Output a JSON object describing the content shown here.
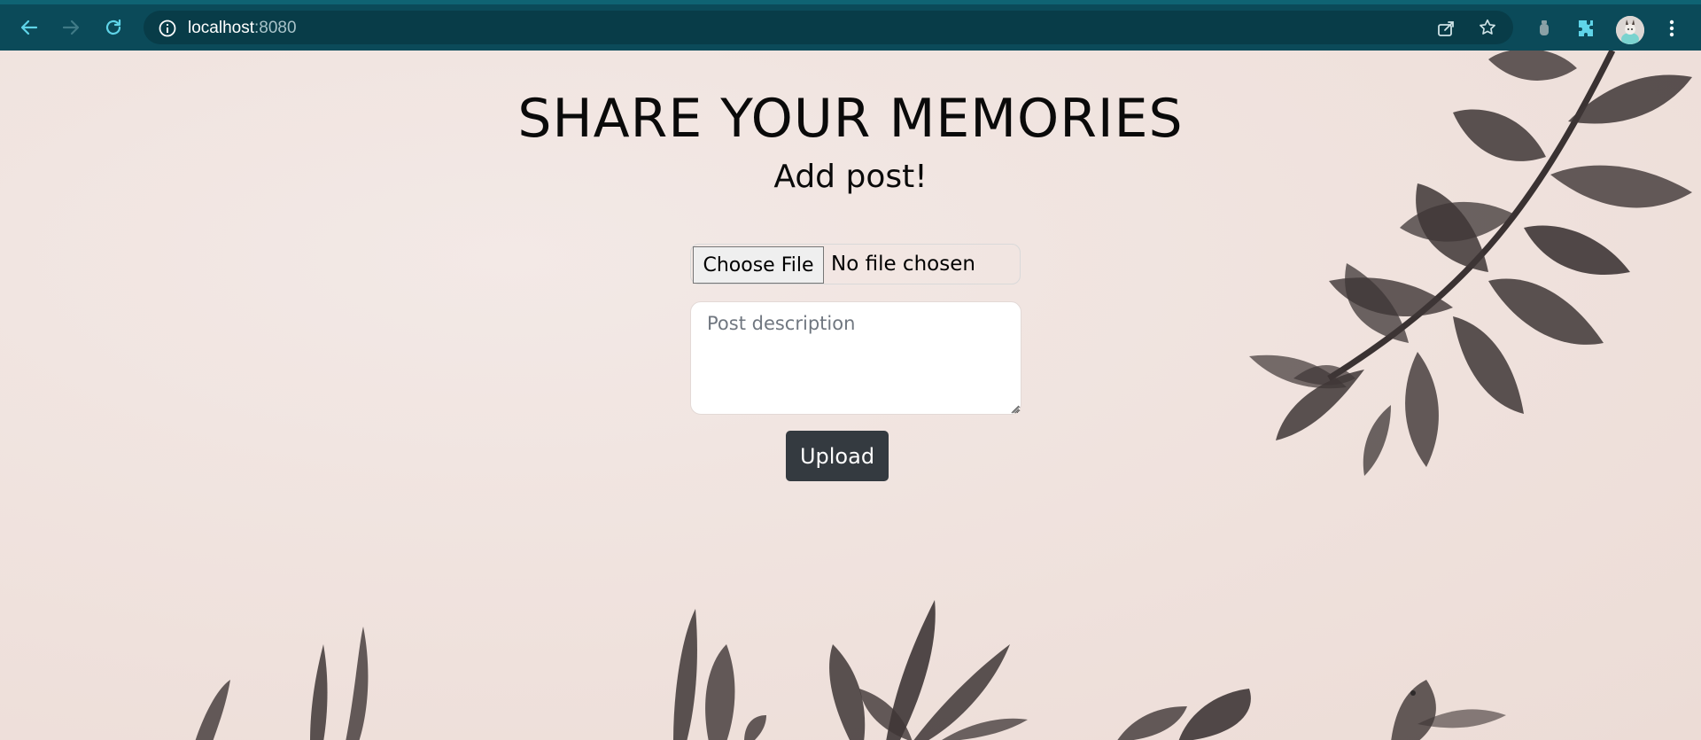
{
  "browser": {
    "url_host": "localhost",
    "url_port": ":8080",
    "colors": {
      "toolbar": "#0b4a59",
      "omnibox": "#083c48",
      "icon": "#ffffff",
      "accent_icon": "#5fd4e8"
    },
    "icons": [
      "back-arrow-icon",
      "forward-arrow-icon",
      "reload-icon",
      "info-icon",
      "share-icon",
      "star-icon",
      "extension-bottle-icon",
      "puzzle-icon",
      "profile-avatar",
      "more-vert-icon"
    ]
  },
  "page": {
    "title": "SHARE YOUR MEMORIES",
    "subtitle": "Add post!",
    "file_input": {
      "button_label": "Choose File",
      "status": "No file chosen"
    },
    "description": {
      "placeholder": "Post description",
      "value": ""
    },
    "upload_label": "Upload",
    "colors": {
      "background": "#efe1dc",
      "button": "#343a40",
      "text": "#0a0a0a",
      "foliage": "#3e3636"
    }
  }
}
